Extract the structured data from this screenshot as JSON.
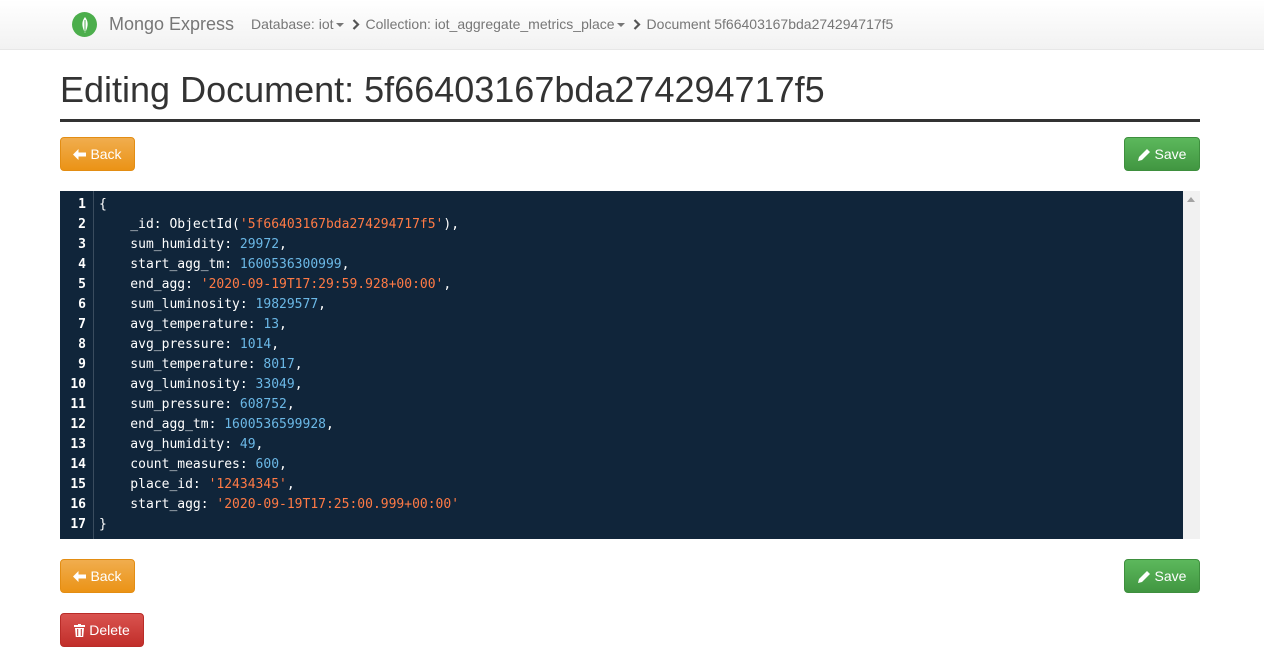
{
  "navbar": {
    "brand": "Mongo Express",
    "breadcrumbs": [
      {
        "label": "Database: iot",
        "dropdown": true
      },
      {
        "label": "Collection: iot_aggregate_metrics_place",
        "dropdown": true
      },
      {
        "label": "Document 5f66403167bda274294717f5",
        "dropdown": false
      }
    ]
  },
  "page": {
    "title": "Editing Document: 5f66403167bda274294717f5"
  },
  "buttons": {
    "back": "Back",
    "save": "Save",
    "delete": "Delete"
  },
  "colors": {
    "warning": "#f0ad4e",
    "success": "#5cb85c",
    "danger": "#d9534f",
    "editor_bg": "#10253a",
    "string": "#ff7a45",
    "number": "#6bb8e6"
  },
  "editor": {
    "lines": [
      {
        "n": "1",
        "parts": [
          [
            "p",
            "{"
          ]
        ]
      },
      {
        "n": "2",
        "parts": [
          [
            "k",
            "    _id: ObjectId("
          ],
          [
            "s",
            "'5f66403167bda274294717f5'"
          ],
          [
            "k",
            "),"
          ]
        ]
      },
      {
        "n": "3",
        "parts": [
          [
            "k",
            "    sum_humidity: "
          ],
          [
            "n",
            "29972"
          ],
          [
            "k",
            ","
          ]
        ]
      },
      {
        "n": "4",
        "parts": [
          [
            "k",
            "    start_agg_tm: "
          ],
          [
            "n",
            "1600536300999"
          ],
          [
            "k",
            ","
          ]
        ]
      },
      {
        "n": "5",
        "parts": [
          [
            "k",
            "    end_agg: "
          ],
          [
            "s",
            "'2020-09-19T17:29:59.928+00:00'"
          ],
          [
            "k",
            ","
          ]
        ]
      },
      {
        "n": "6",
        "parts": [
          [
            "k",
            "    sum_luminosity: "
          ],
          [
            "n",
            "19829577"
          ],
          [
            "k",
            ","
          ]
        ]
      },
      {
        "n": "7",
        "parts": [
          [
            "k",
            "    avg_temperature: "
          ],
          [
            "n",
            "13"
          ],
          [
            "k",
            ","
          ]
        ]
      },
      {
        "n": "8",
        "parts": [
          [
            "k",
            "    avg_pressure: "
          ],
          [
            "n",
            "1014"
          ],
          [
            "k",
            ","
          ]
        ]
      },
      {
        "n": "9",
        "parts": [
          [
            "k",
            "    sum_temperature: "
          ],
          [
            "n",
            "8017"
          ],
          [
            "k",
            ","
          ]
        ]
      },
      {
        "n": "10",
        "parts": [
          [
            "k",
            "    avg_luminosity: "
          ],
          [
            "n",
            "33049"
          ],
          [
            "k",
            ","
          ]
        ]
      },
      {
        "n": "11",
        "parts": [
          [
            "k",
            "    sum_pressure: "
          ],
          [
            "n",
            "608752"
          ],
          [
            "k",
            ","
          ]
        ]
      },
      {
        "n": "12",
        "parts": [
          [
            "k",
            "    end_agg_tm: "
          ],
          [
            "n",
            "1600536599928"
          ],
          [
            "k",
            ","
          ]
        ]
      },
      {
        "n": "13",
        "parts": [
          [
            "k",
            "    avg_humidity: "
          ],
          [
            "n",
            "49"
          ],
          [
            "k",
            ","
          ]
        ]
      },
      {
        "n": "14",
        "parts": [
          [
            "k",
            "    count_measures: "
          ],
          [
            "n",
            "600"
          ],
          [
            "k",
            ","
          ]
        ]
      },
      {
        "n": "15",
        "parts": [
          [
            "k",
            "    place_id: "
          ],
          [
            "s",
            "'12434345'"
          ],
          [
            "k",
            ","
          ]
        ]
      },
      {
        "n": "16",
        "parts": [
          [
            "k",
            "    start_agg: "
          ],
          [
            "s",
            "'2020-09-19T17:25:00.999+00:00'"
          ]
        ]
      },
      {
        "n": "17",
        "parts": [
          [
            "p",
            "}"
          ]
        ]
      }
    ]
  }
}
